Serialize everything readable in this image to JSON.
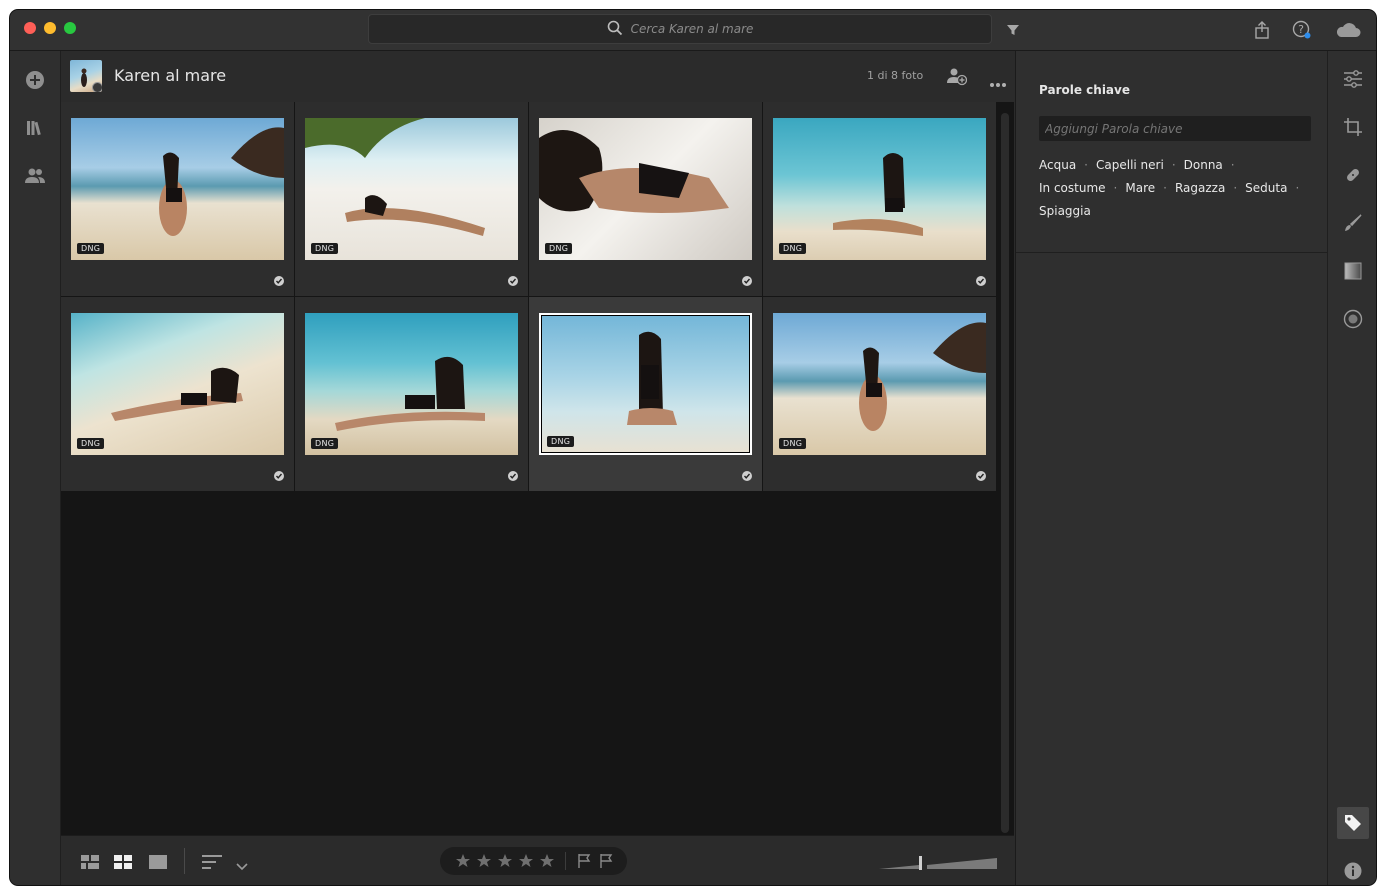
{
  "window": {
    "search_placeholder": "Cerca Karen al mare",
    "traffic_colors": [
      "#fe5f57",
      "#febc2e",
      "#28c840"
    ]
  },
  "album": {
    "title": "Karen al mare",
    "count": "1 di 8 foto"
  },
  "photos": [
    {
      "badge": "DNG",
      "scene": "kneeling-beach-rock",
      "selected": false
    },
    {
      "badge": "DNG",
      "scene": "lying-sand-palm",
      "selected": false
    },
    {
      "badge": "DNG",
      "scene": "lying-sand-closeup",
      "selected": false
    },
    {
      "badge": "DNG",
      "scene": "sitting-shore",
      "selected": false
    },
    {
      "badge": "DNG",
      "scene": "lying-shore-wave",
      "selected": false
    },
    {
      "badge": "DNG",
      "scene": "lying-shore-water",
      "selected": false
    },
    {
      "badge": "DNG",
      "scene": "sitting-shallow",
      "selected": true
    },
    {
      "badge": "DNG",
      "scene": "kneeling-beach-rock",
      "selected": false
    }
  ],
  "keywords_panel": {
    "title": "Parole chiave",
    "input_placeholder": "Aggiungi Parola chiave",
    "keywords": [
      "Acqua",
      "Capelli neri",
      "Donna",
      "In costume",
      "Mare",
      "Ragazza",
      "Seduta",
      "Spiaggia"
    ]
  },
  "colors": {
    "accent_blue": "#2d8ceb",
    "panel": "#2f2f2f",
    "grid_bg": "#151515"
  }
}
